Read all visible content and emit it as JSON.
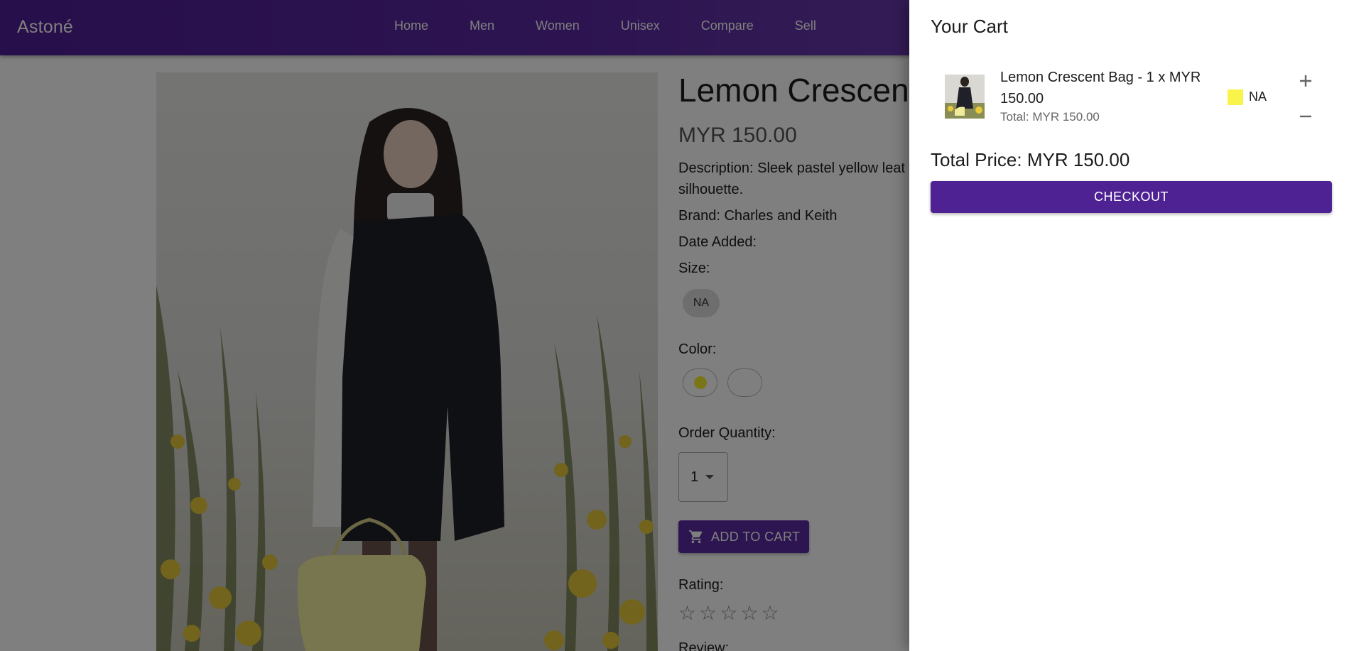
{
  "navbar": {
    "brand": "Astoné",
    "links": [
      "Home",
      "Men",
      "Women",
      "Unisex",
      "Compare",
      "Sell"
    ]
  },
  "product": {
    "title": "Lemon Crescent",
    "price": "MYR 150.00",
    "description_line1": "Description: Sleek pastel yellow leat",
    "description_line2": "silhouette.",
    "brand": "Brand: Charles and Keith",
    "date_added": "Date Added:",
    "size_label": "Size:",
    "size_option": "NA",
    "color_label": "Color:",
    "color_options": [
      "#f5eb2f",
      "#ffffff"
    ],
    "quantity_label": "Order Quantity:",
    "quantity_value": "1",
    "add_to_cart_label": "ADD TO CART",
    "rating_label": "Rating:",
    "rating_value": 0,
    "rating_max": 5,
    "review_label": "Review:"
  },
  "cart": {
    "title": "Your Cart",
    "item": {
      "name": "Lemon Crescent Bag - 1 x MYR 150.00",
      "total": "Total: MYR 150.00",
      "color": "#f8f44a",
      "size": "NA"
    },
    "total_price": "Total Price: MYR 150.00",
    "checkout_label": "CHECKOUT"
  },
  "colors": {
    "brand_purple": "#5b2aa3",
    "checkout_purple": "#4f2294"
  }
}
